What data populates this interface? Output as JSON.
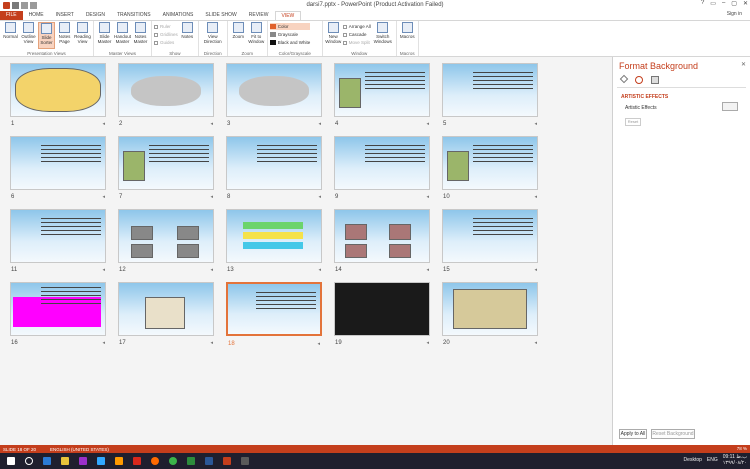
{
  "titlebar": {
    "title": "darsi7.pptx - PowerPoint (Product Activation Failed)",
    "controls": [
      "?",
      "▭",
      "–",
      "▢",
      "✕"
    ]
  },
  "tabs": [
    "FILE",
    "HOME",
    "INSERT",
    "DESIGN",
    "TRANSITIONS",
    "ANIMATIONS",
    "SLIDE SHOW",
    "REVIEW",
    "VIEW"
  ],
  "active_tab": "VIEW",
  "user": "Sign in",
  "ribbon": {
    "presentation_views": {
      "label": "Presentation Views",
      "buttons": [
        "Normal",
        "Outline View",
        "Slide Sorter",
        "Notes Page",
        "Reading View"
      ]
    },
    "master_views": {
      "label": "Master Views",
      "buttons": [
        "Slide Master",
        "Handout Master",
        "Notes Master"
      ]
    },
    "show": {
      "label": "Show",
      "items": [
        "Ruler",
        "Gridlines",
        "Guides"
      ],
      "notes": "Notes"
    },
    "direction": {
      "label": "Direction",
      "button": "View Direction"
    },
    "zoom": {
      "label": "Zoom",
      "buttons": [
        "Zoom",
        "Fit to Window"
      ]
    },
    "color": {
      "label": "Color/Grayscale",
      "items": [
        "Color",
        "Grayscale",
        "Black and White"
      ]
    },
    "window": {
      "label": "Window",
      "new_window": "New Window",
      "items": [
        "Arrange All",
        "Cascade",
        "Move Split"
      ],
      "switch": "Switch Windows"
    },
    "macros": {
      "label": "Macros",
      "button": "Macros"
    }
  },
  "slides": [
    {
      "n": "1"
    },
    {
      "n": "2"
    },
    {
      "n": "3"
    },
    {
      "n": "4"
    },
    {
      "n": "5"
    },
    {
      "n": "6"
    },
    {
      "n": "7"
    },
    {
      "n": "8"
    },
    {
      "n": "9"
    },
    {
      "n": "10"
    },
    {
      "n": "11"
    },
    {
      "n": "12"
    },
    {
      "n": "13"
    },
    {
      "n": "14"
    },
    {
      "n": "15"
    },
    {
      "n": "16"
    },
    {
      "n": "17"
    },
    {
      "n": "18"
    },
    {
      "n": "19"
    },
    {
      "n": "20"
    }
  ],
  "selected_slide": "18",
  "pane": {
    "title": "Format Background",
    "close": "✕",
    "section": "ARTISTIC EFFECTS",
    "artistic_label": "Artistic Effects",
    "reset": "Reset",
    "apply_all": "Apply to All",
    "reset_bg": "Reset Background"
  },
  "status": {
    "slide": "SLIDE 18 OF 20",
    "lang": "ENGLISH (UNITED STATES)",
    "zoom": "78 %"
  },
  "taskbar": {
    "desktop": "Desktop",
    "lang": "ENG",
    "time": "09:11 ب.ظ",
    "date": "۱۳۹۹/۰۸/۲۰"
  },
  "colors": {
    "accent": "#c43e1c",
    "pane_title": "#c43e1c",
    "selection": "#e3733a"
  }
}
